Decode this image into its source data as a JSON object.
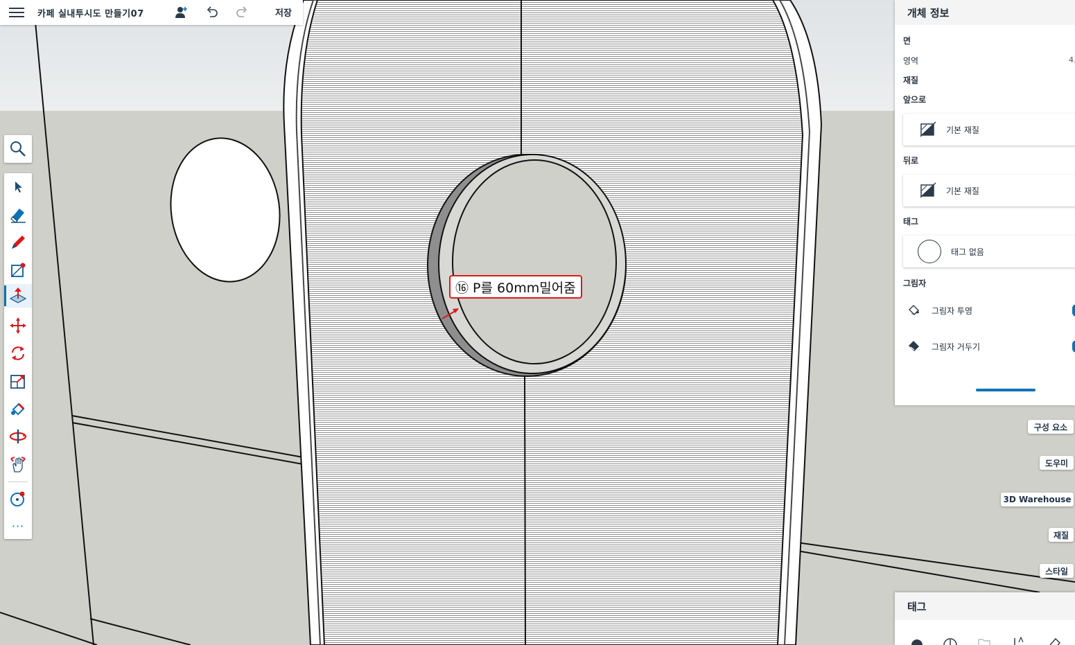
{
  "app": {
    "title": "카페 실내투시도 만들기07",
    "save_label": "저장"
  },
  "toolbar": {
    "tools": [
      "search-icon",
      "select-icon",
      "eraser-icon",
      "pencil-icon",
      "shape-icon",
      "push-pull-icon",
      "move-icon",
      "rotate-icon",
      "scale-icon",
      "paint-icon",
      "orbit-icon",
      "pan-icon",
      "tape-measure-icon"
    ],
    "active_tool": "push-pull-icon",
    "more_label": "···"
  },
  "annotation": {
    "text": "⑯ P를 60mm밀어줌",
    "color": "#d81b1b"
  },
  "entity_info": {
    "title": "개체 정보",
    "type_label": "면",
    "area_label": "영역",
    "area_value": "4.",
    "material_label": "재질",
    "front_label": "앞으로",
    "front_material": "기본 재질",
    "back_label": "뒤로",
    "back_material": "기본 재질",
    "tag_label": "태그",
    "tag_value": "태그 없음",
    "shadow_label": "그림자",
    "cast_shadows": "그림자 투영",
    "receive_shadows": "그림자 거두기"
  },
  "side_tabs": [
    "구성 요소",
    "도우미",
    "3D Warehouse",
    "재질",
    "스타일"
  ],
  "tags_panel": {
    "title": "태그"
  },
  "colors": {
    "accent": "#0a72b5",
    "annotation_border": "#d81b1b",
    "background": "#cfd0ca"
  }
}
